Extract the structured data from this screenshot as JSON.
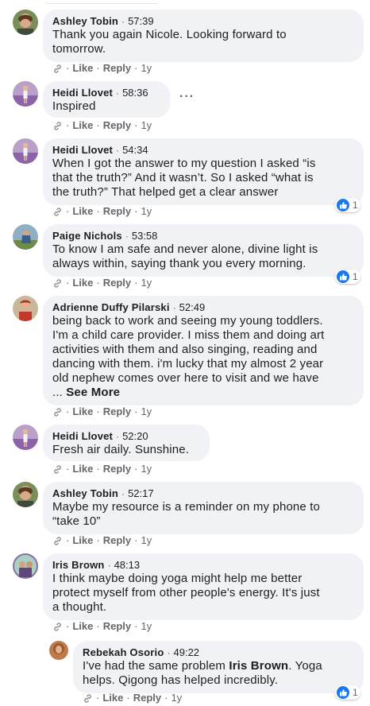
{
  "actions": {
    "like": "Like",
    "reply": "Reply"
  },
  "comments": [
    {
      "author": "Ashley Tobin",
      "time": "57:39",
      "text": [
        "Thank you again Nicole. Looking forward to",
        "tomorrow."
      ],
      "age": "1y"
    },
    {
      "author": "Heidi Llovet",
      "time": "58:36",
      "text": [
        "Inspired"
      ],
      "age": "1y",
      "more_icon": "more-horizontal-icon"
    },
    {
      "author": "Heidi Llovet",
      "time": "54:34",
      "text": [
        "When I got the answer to my question I asked “is",
        "that the truth?” And it wasn’t. So I asked “what is",
        "the truth?” That helped get a clear answer"
      ],
      "age": "1y",
      "reactions": "1"
    },
    {
      "author": "Paige Nichols",
      "time": "53:58",
      "text": [
        "To know I am safe and never alone, divine light is",
        "always within, saying thank you every morning."
      ],
      "age": "1y",
      "reactions": "1"
    },
    {
      "author": "Adrienne Duffy Pilarski",
      "time": "52:49",
      "text": [
        "being back to work and seeing my young toddlers.",
        "I'm a child care provider. I miss them and doing art",
        "activities with them and also singing, reading and",
        "dancing with them. i'm lucky that my almost 2 year",
        "old nephew comes over here to visit and we have"
      ],
      "see_more_prefix": "... ",
      "see_more": "See More",
      "age": "1y"
    },
    {
      "author": "Heidi Llovet",
      "time": "52:20",
      "text": [
        "Fresh air daily. Sunshine."
      ],
      "age": "1y"
    },
    {
      "author": "Ashley Tobin",
      "time": "52:17",
      "text": [
        "Maybe my resource is a reminder on my phone to",
        "“take 10”"
      ],
      "age": "1y"
    },
    {
      "author": "Iris Brown",
      "time": "48:13",
      "text": [
        "I think maybe doing yoga might help me better",
        "protect myself from other people's energy. It's just",
        "a thought."
      ],
      "age": "1y"
    }
  ],
  "reply": {
    "author": "Rebekah Osorio",
    "time": "49:22",
    "line1_pre": "I've had the same problem ",
    "line1_mention": "Iris Brown",
    "line1_post": ". Yoga",
    "line2": "helps. Qigong has helped incredibly.",
    "age": "1y",
    "reactions": "1"
  },
  "colors": {
    "bubble": "#f0f2f5",
    "time_dot": "#e0245e",
    "like_blue": "#1877f2",
    "secondary": "#65676b"
  }
}
